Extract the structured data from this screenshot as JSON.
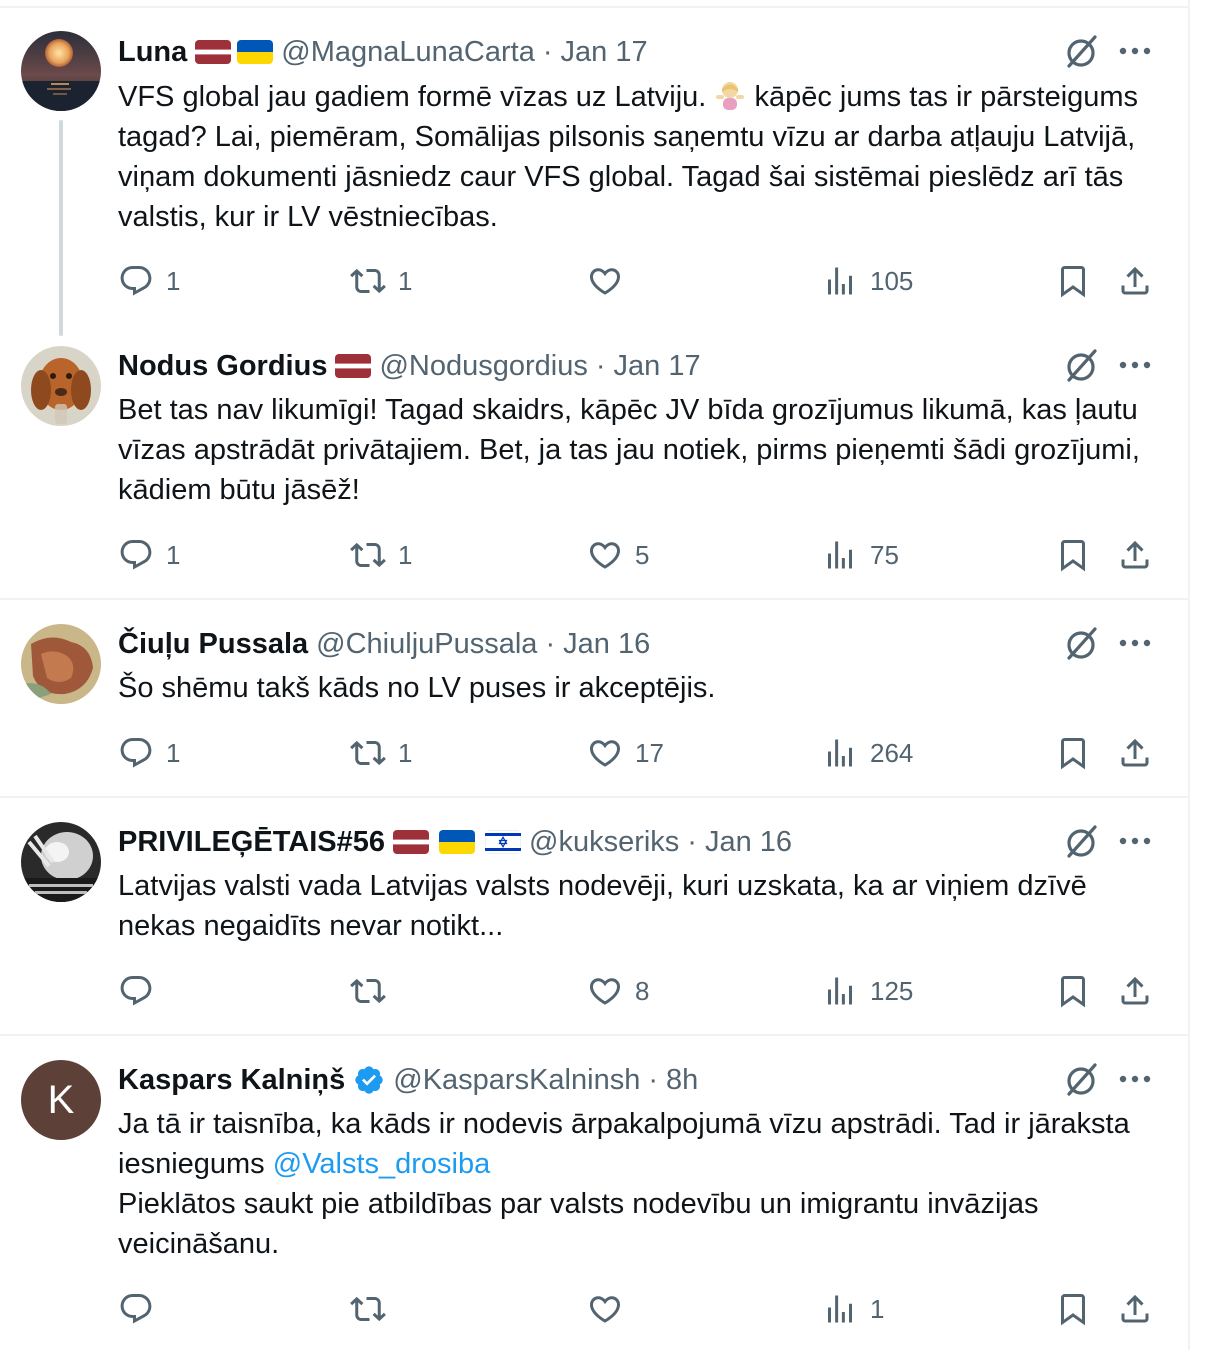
{
  "tweets": [
    {
      "name": "Luna",
      "flags": [
        "latvia",
        "ukraine"
      ],
      "handle": "@MagnaLunaCarta",
      "dot": "·",
      "time": "Jan 17",
      "text_before_emoji": "VFS global jau gadiem formē vīzas uz Latviju.",
      "emoji": "person-shrugging-emoji",
      "text_after_emoji": "kāpēc jums tas ir pārsteigums tagad? Lai, piemēram, Somālijas pilsonis saņemtu vīzu ar darba atļauju Latvijā, viņam dokumenti jāsniedz caur VFS global. Tagad šai sistēmai pieslēdz arī tās valstis, kur ir LV vēstniecības.",
      "replies": "1",
      "reposts": "1",
      "likes": "",
      "views": "105"
    },
    {
      "name": "Nodus Gordius",
      "flags": [
        "latvia"
      ],
      "handle": "@Nodusgordius",
      "dot": "·",
      "time": "Jan 17",
      "text": "Bet tas nav likumīgi! Tagad skaidrs, kāpēc JV bīda grozījumus likumā, kas ļautu vīzas apstrādāt privātajiem. Bet, ja tas jau notiek, pirms pieņemti šādi grozījumi, kādiem būtu jāsēž!",
      "replies": "1",
      "reposts": "1",
      "likes": "5",
      "views": "75"
    },
    {
      "name": "Čiuļu Pussala",
      "flags": [],
      "handle": "@ChiuljuPussala",
      "dot": "·",
      "time": "Jan 16",
      "text": "Šo shēmu takš kāds no LV puses ir akceptējis.",
      "replies": "1",
      "reposts": "1",
      "likes": "17",
      "views": "264"
    },
    {
      "name": "PRIVILEĢĒTAIS#56",
      "flags": [
        "latvia",
        "ukraine",
        "israel"
      ],
      "handle": "@kukseriks",
      "dot": "·",
      "time": "Jan 16",
      "text": "Latvijas valsti vada Latvijas valsts nodevēji, kuri uzskata, ka ar viņiem dzīvē nekas negaidīts nevar notikt...",
      "replies": "",
      "reposts": "",
      "likes": "8",
      "views": "125"
    },
    {
      "name": "Kaspars Kalniņš",
      "avatar_letter": "K",
      "verified": true,
      "flags": [],
      "handle": "@KasparsKalninsh",
      "dot": "·",
      "time": "8h",
      "text_line1": "Ja tā ir taisnība, ka kāds ir nodevis ārpakalpojumā vīzu apstrādi. Tad ir jāraksta iesniegums",
      "mention": "@Valsts_drosiba",
      "text_line2": "Pieklātos saukt pie atbildības par valsts nodevību un imigrantu invāzijas veicināšanu.",
      "replies": "",
      "reposts": "",
      "likes": "",
      "views": "1"
    }
  ],
  "icons": {
    "reply": "reply-bubble-icon",
    "repost": "repost-arrows-icon",
    "like": "heart-icon",
    "views": "views-bar-chart-icon",
    "bookmark": "bookmark-icon",
    "share": "share-upload-icon",
    "grok": "grok-slash-circle-icon",
    "more": "more-dots-icon",
    "verified": "verified-badge-icon"
  },
  "colors": {
    "text": "#0f1419",
    "secondary": "#536471",
    "link": "#1d9bf0",
    "separator": "#eff3f4",
    "thread_line": "#cfd9de",
    "avatar_k_bg": "#5d4037"
  }
}
